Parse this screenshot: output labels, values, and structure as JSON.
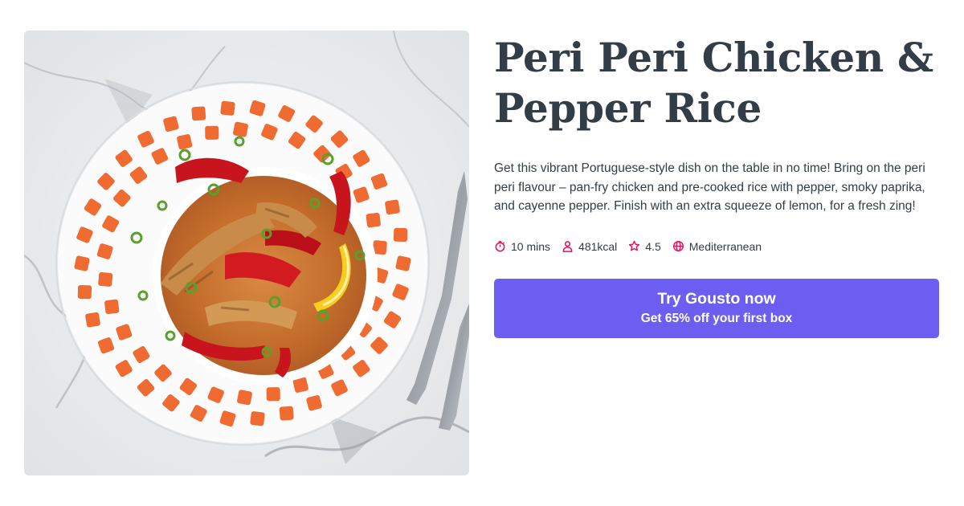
{
  "recipe": {
    "title": "Peri Peri Chicken & Pepper Rice",
    "description": "Get this vibrant Portuguese-style dish on the table in no time! Bring on the peri peri flavour – pan-fry chicken and pre-cooked rice with pepper, smoky paprika, and cayenne pepper. Finish with an extra squeeze of lemon, for a fresh zing!",
    "image_alt": "Peri Peri Chicken & Pepper Rice"
  },
  "meta": [
    {
      "icon": "timer-icon",
      "text": "10 mins"
    },
    {
      "icon": "person-icon",
      "text": "481kcal"
    },
    {
      "icon": "star-icon",
      "text": "4.5"
    },
    {
      "icon": "globe-icon",
      "text": "Mediterranean"
    }
  ],
  "cta": {
    "title": "Try Gousto now",
    "subtitle": "Get 65% off your first box"
  },
  "colors": {
    "accent": "#6b5ef0",
    "icon": "#e0115f",
    "text": "#333d47"
  }
}
